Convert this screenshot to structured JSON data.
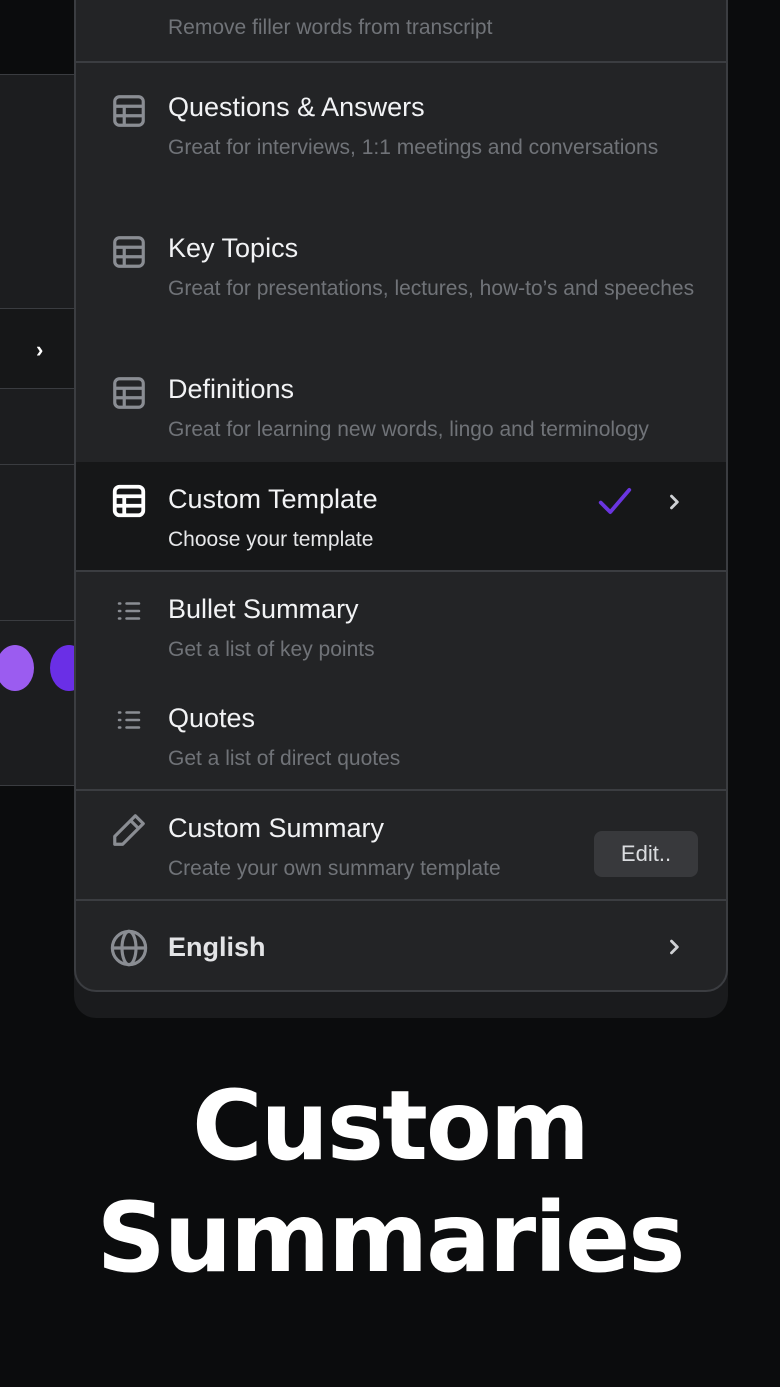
{
  "menu": {
    "filler": {
      "subtitle": "Remove filler words from transcript"
    },
    "items": [
      {
        "title": "Questions & Answers",
        "subtitle": "Great for interviews, 1:1 meetings and conversations",
        "icon": "table-icon"
      },
      {
        "title": "Key Topics",
        "subtitle": "Great for presentations, lectures, how-to’s and speeches",
        "icon": "table-icon"
      },
      {
        "title": "Definitions",
        "subtitle": "Great for learning new words, lingo and terminology",
        "icon": "table-icon"
      },
      {
        "title": "Custom Template",
        "subtitle": "Choose your template",
        "icon": "table-icon",
        "selected": true
      },
      {
        "title": "Bullet Summary",
        "subtitle": "Get a list of key points",
        "icon": "list-icon"
      },
      {
        "title": "Quotes",
        "subtitle": "Get a list of direct quotes",
        "icon": "list-icon"
      }
    ],
    "custom_summary": {
      "title": "Custom Summary",
      "subtitle": "Create your own summary template",
      "edit_label": "Edit..",
      "icon": "pencil-icon"
    },
    "language": {
      "label": "English",
      "icon": "globe-icon"
    }
  },
  "headline": {
    "line1": "Custom",
    "line2": "Summaries"
  },
  "colors": {
    "accent": "#6a35e0",
    "panel_bg": "#232426",
    "selected_bg": "#161718",
    "page_bg": "#0b0c0d"
  }
}
